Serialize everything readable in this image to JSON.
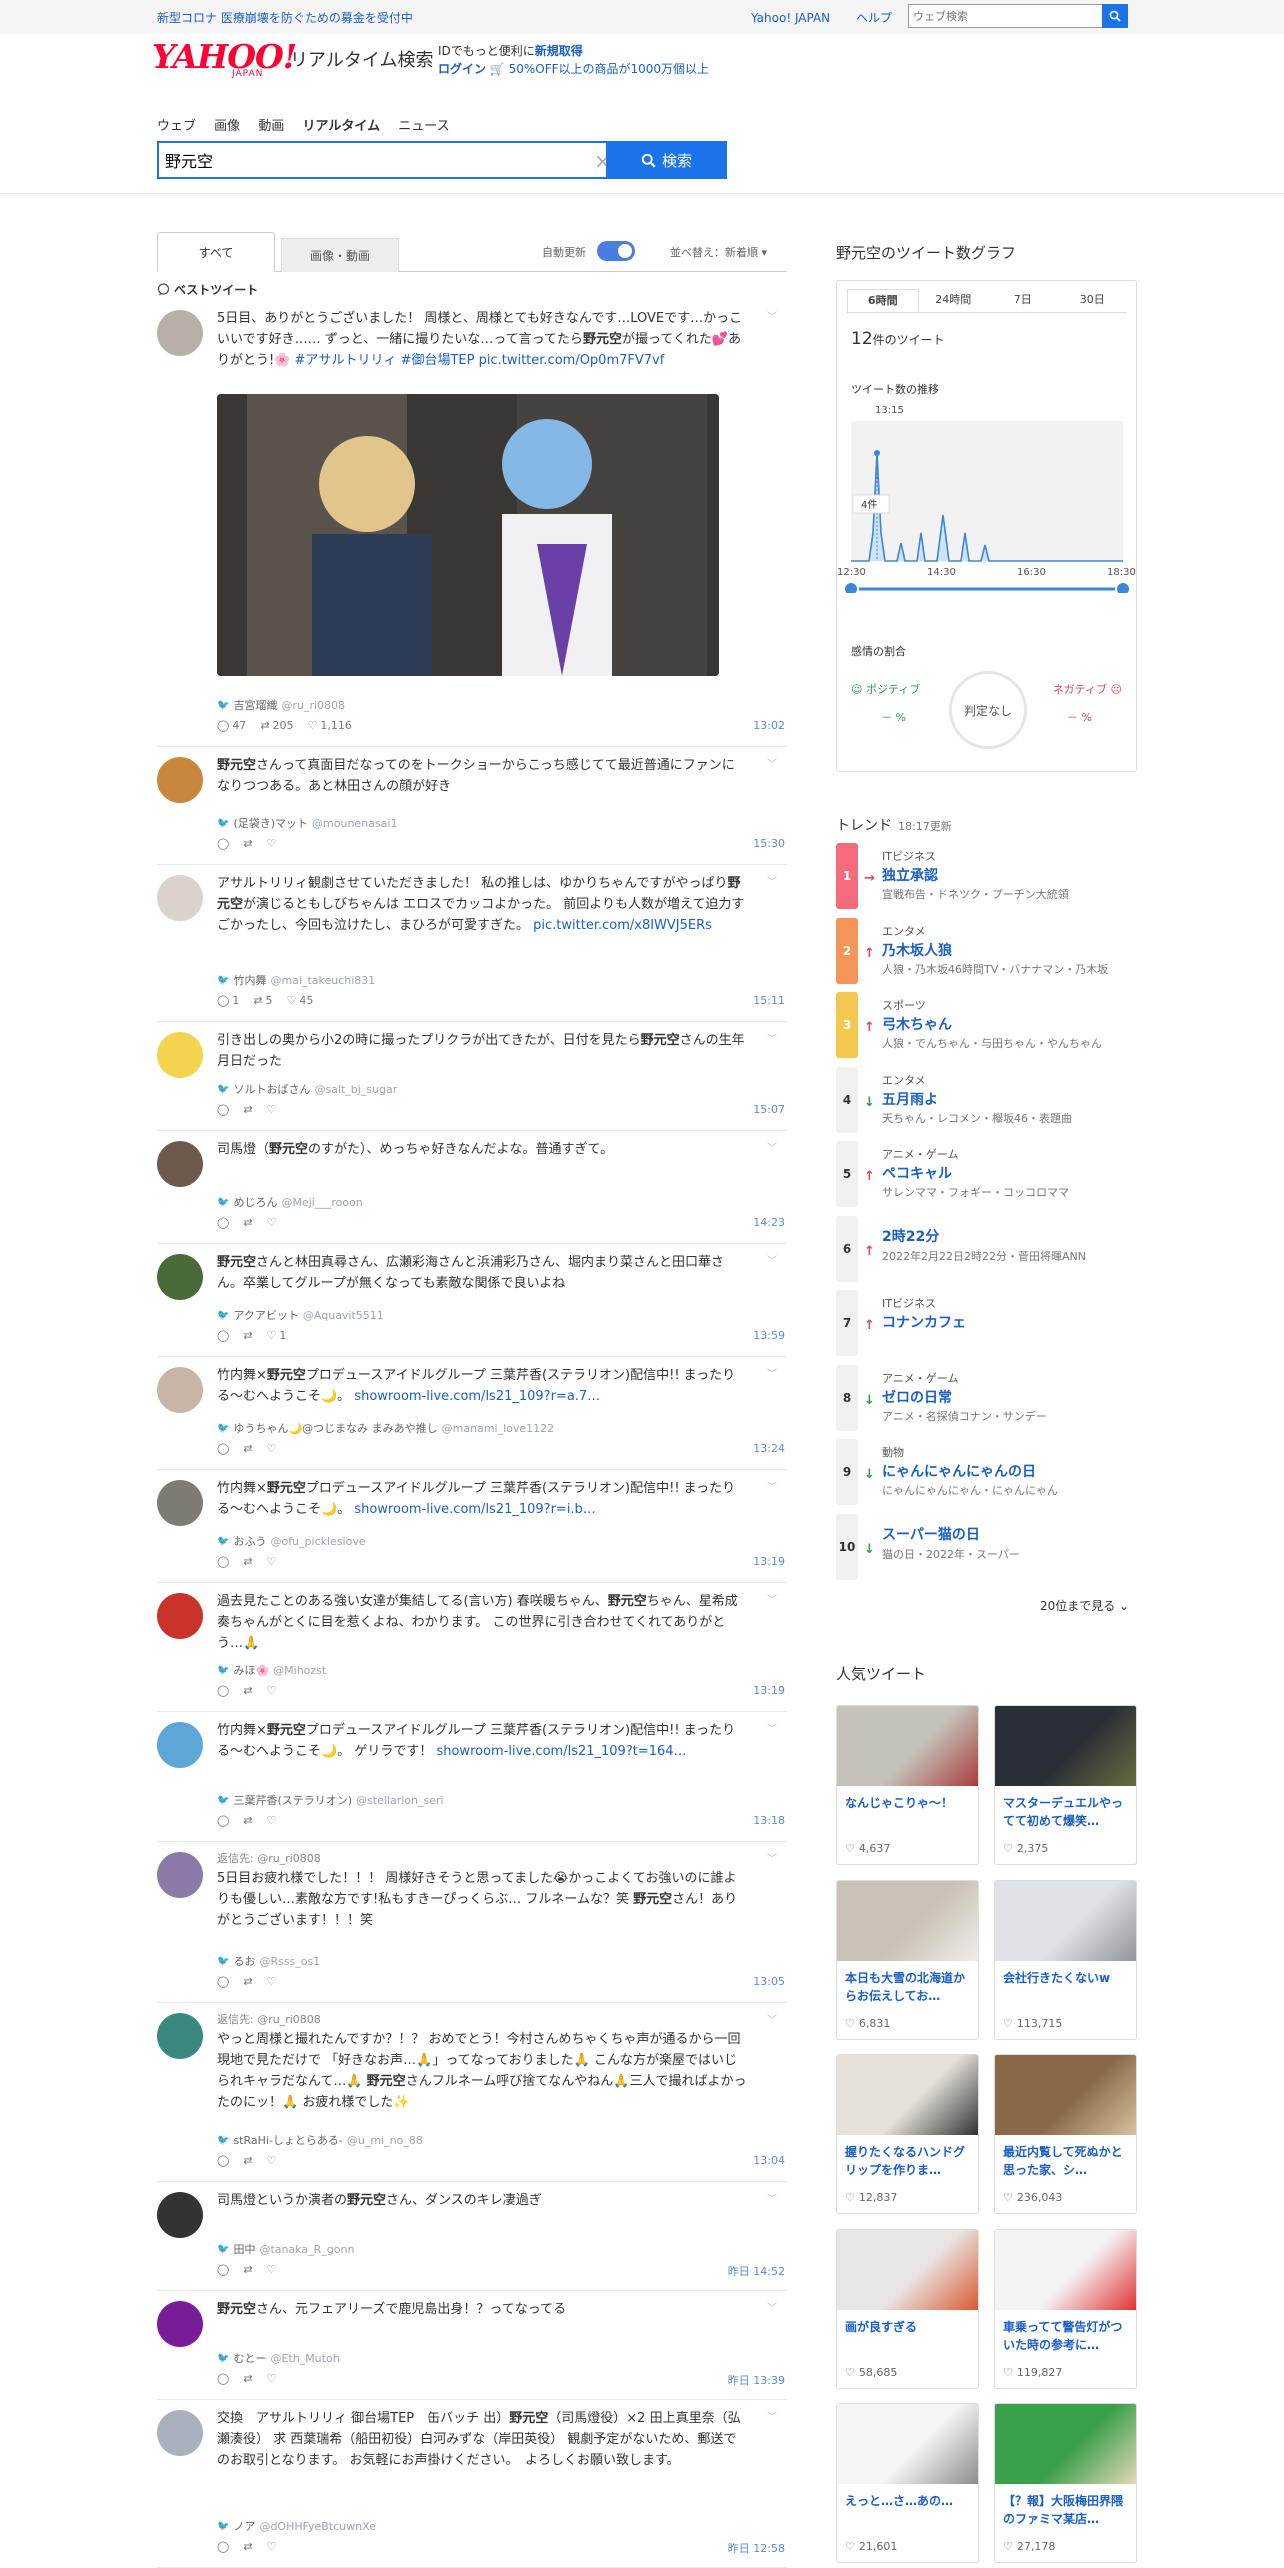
{
  "topbar": {
    "notice": "新型コロナ 医療崩壊を防ぐための募金を受付中",
    "links": [
      "Yahoo! JAPAN",
      "ヘルプ"
    ],
    "search_placeholder": "ウェブ検索"
  },
  "header": {
    "logo": "YAHOO!",
    "logo_sub": "JAPAN",
    "title": "リアルタイム検索",
    "promo_line1_pre": "IDでもっと便利に",
    "promo_line1_link": "新規取得",
    "promo_line2_link": "ログイン",
    "promo_line2_text": "🛒 50%OFF以上の商品が1000万個以上"
  },
  "nav": {
    "tabs": [
      "ウェブ",
      "画像",
      "動画",
      "リアルタイム",
      "ニュース"
    ],
    "active": "リアルタイム"
  },
  "search": {
    "query": "野元空",
    "button": "検索"
  },
  "filters": {
    "tab_all": "すべて",
    "tab_media": "画像・動画",
    "auto_update": "自動更新",
    "sort": "並べ替え：新着順 ▾"
  },
  "best_tweet_label": "ベストツイート",
  "tweets": [
    {
      "pre": "5日目、ありがとうございました！ 周様と、周様とても好きなんです…LOVEです…かっこいいです好き…… ずっと、一緒に撮りたいな…って言ってたら",
      "hl": "野元空",
      "post": "が撮ってくれた💕ありがとう!🌸",
      "link": "#アサルトリリィ #御台場TEP pic.twitter.com/Op0m7FV7vf",
      "user": "吉宮瑠織",
      "handle": "@ru_ri0808",
      "replies": "47",
      "retweets": "205",
      "likes": "1,116",
      "time": "13:02"
    },
    {
      "pre": "",
      "hl": "野元空",
      "post": "さんって真面目だなってのをトークショーからこっち感じてて最近普通にファンになりつつある。あと林田さんの顔が好き",
      "user": "(足袋き)マット",
      "handle": "@mounenasai1",
      "time": "15:30"
    },
    {
      "pre": "アサルトリリィ観劇させていただきました！ 私の推しは、ゆかりちゃんですがやっぱり",
      "hl": "野元空",
      "post": "が演じるともしびちゃんは エロスでカッコよかった。 前回よりも人数が増えて迫力すごかったし、今回も泣けたし、まひろが可愛すぎた。",
      "link": "pic.twitter.com/x8IWVJ5ERs",
      "user": "竹内舞",
      "handle": "@mai_takeuchi831",
      "replies": "1",
      "retweets": "5",
      "likes": "45",
      "time": "15:11"
    },
    {
      "pre": "引き出しの奥から小2の時に撮ったプリクラが出てきたが、日付を見たら",
      "hl": "野元空",
      "post": "さんの生年月日だった",
      "user": "ソルトおばさん",
      "handle": "@salt_bj_sugar",
      "time": "15:07"
    },
    {
      "pre": "司馬燈（",
      "hl": "野元空",
      "post": "のすがた）、めっちゃ好きなんだよな。普通すぎて。",
      "user": "めじろん",
      "handle": "@Meji___rooon",
      "time": "14:23"
    },
    {
      "pre": "",
      "hl": "野元空",
      "post": "さんと林田真尋さん、広瀬彩海さんと浜浦彩乃さん、堀内まり菜さんと田口華さん。卒業してグループが無くなっても素敵な関係で良いよね",
      "user": "アクアビット",
      "handle": "@Aquavit5511",
      "likes": "1",
      "time": "13:59"
    },
    {
      "pre": "竹内舞×",
      "hl": "野元空",
      "post": "プロデュースアイドルグループ 三葉芹香(ステラリオン)配信中!! まったりる〜むへようこそ🌙。",
      "link": "showroom-live.com/ls21_109?r=a.7…",
      "user": "ゆうちゃん🌙@つじまなみ まみあや推し",
      "handle": "@manami_love1122",
      "time": "13:24"
    },
    {
      "pre": "竹内舞×",
      "hl": "野元空",
      "post": "プロデュースアイドルグループ 三葉芹香(ステラリオン)配信中!! まったりる〜むへようこそ🌙。",
      "link": "showroom-live.com/ls21_109?r=i.b…",
      "user": "おふう",
      "handle": "@ofu_pickleslove",
      "time": "13:19"
    },
    {
      "pre": "過去見たことのある強い女達が集結してる(言い方) 春咲暖ちゃん、",
      "hl": "野元空",
      "post": "ちゃん、星希成奏ちゃんがとくに目を惹くよね、わかります。 この世界に引き合わせてくれてありがとう…🙏",
      "user": "みほ🌸",
      "handle": "@Mihozst",
      "time": "13:19"
    },
    {
      "pre": "竹内舞×",
      "hl": "野元空",
      "post": "プロデュースアイドルグループ 三葉芹香(ステラリオン)配信中!! まったりる〜むへようこそ🌙。 ゲリラです！",
      "link": "showroom-live.com/ls21_109?t=164…",
      "user": "三葉芹香(ステラリオン)",
      "handle": "@stellarion_seri",
      "time": "13:18"
    },
    {
      "reply_to": "返信先: @ru_ri0808",
      "pre": "5日目お疲れ様でした！！！ 周様好きそうと思ってました😭かっこよくてお強いのに誰よりも優しい…素敵な方です!私もすきーぴっくらぶ… フルネームな？笑 ",
      "hl": "野元空",
      "post": "さん！ありがとうございます！！！笑",
      "user": "るお",
      "handle": "@Rsss_os1",
      "time": "13:05"
    },
    {
      "reply_to": "返信先: @ru_ri0808",
      "pre": "やっと周様と撮れたんですか？！？ おめでとう！今村さんめちゃくちゃ声が通るから一回現地で見ただけで 「好きなお声…🙏」ってなっておりました🙏 こんな方が楽屋ではいじられキャラだなんて…🙏 ",
      "hl": "野元空",
      "post": "さんフルネーム呼び捨てなんやねん🙏三人で撮ればよかったのにッ！🙏 お疲れ様でした✨",
      "user": "stRaHi-しょとらある-",
      "handle": "@u_mi_no_88",
      "time": "13:04"
    },
    {
      "pre": "司馬燈というか演者の",
      "hl": "野元空",
      "post": "さん、ダンスのキレ凄過ぎ",
      "user": "田中",
      "handle": "@tanaka_R_gonn",
      "time": "昨日 14:52"
    },
    {
      "pre": "",
      "hl": "野元空",
      "post": "さん、元フェアリーズで鹿児島出身！？ってなってる",
      "user": "むとー",
      "handle": "@Eth_Mutoh",
      "time": "昨日 13:39"
    },
    {
      "pre": "交換　アサルトリリィ 御台場TEP　缶バッチ 出）",
      "hl": "野元空",
      "post": "（司馬燈役）×2 田上真里奈（弘瀬湊役） 求 西葉瑞希（船田初役）白河みずな（岸田英役） 観劇予定がないため、郵送でのお取引となります。 お気軽にお声掛けください。　よろしくお願い致します。",
      "user": "ノア",
      "handle": "@dOHHFyeBtcuwnXe",
      "time": "昨日 12:58"
    }
  ],
  "graph": {
    "title": "野元空のツイート数グラフ",
    "tabs": [
      "6時間",
      "24時間",
      "7日",
      "30日"
    ],
    "active_tab": "6時間",
    "count_num": "12",
    "count_suffix": "件のツイート",
    "trend_label": "ツイート数の推移",
    "peak_time": "13:15",
    "peak_value": "4件",
    "x_ticks": [
      "12:30",
      "14:30",
      "16:30",
      "18:30"
    ],
    "sentiment_label": "感情の割合",
    "positive_label": "ポジティブ",
    "negative_label": "ネガティブ",
    "positive_value": "－ %",
    "negative_value": "－ %",
    "judgement": "判定なし"
  },
  "chart_data": {
    "type": "area",
    "x": [
      "12:30",
      "14:30",
      "16:30",
      "18:30"
    ],
    "peak": {
      "x": "13:15",
      "y": 4
    },
    "total": 12
  },
  "trends": {
    "title": "トレンド",
    "updated": "18:17更新",
    "items": [
      {
        "rank": "1",
        "cat": "ITビジネス",
        "name": "独立承認",
        "rel": "宣戦布告・ドネツク・プーチン大統領",
        "dir": "→",
        "color": "#f46b7b"
      },
      {
        "rank": "2",
        "cat": "エンタメ",
        "name": "乃木坂人狼",
        "rel": "人狼・乃木坂46時間TV・バナナマン・乃木坂",
        "dir": "↑",
        "color": "#f59458"
      },
      {
        "rank": "3",
        "cat": "スポーツ",
        "name": "弓木ちゃん",
        "rel": "人狼・でんちゃん・与田ちゃん・やんちゃん",
        "dir": "↑",
        "color": "#f4c84e"
      },
      {
        "rank": "4",
        "cat": "エンタメ",
        "name": "五月雨よ",
        "rel": "天ちゃん・レコメン・欅坂46・表題曲",
        "dir": "↓",
        "color": "#f0f0f0"
      },
      {
        "rank": "5",
        "cat": "アニメ・ゲーム",
        "name": "ペコキャル",
        "rel": "サレンママ・フォギー・コッコロママ",
        "dir": "↑",
        "color": "#f0f0f0"
      },
      {
        "rank": "6",
        "cat": "",
        "name": "2時22分",
        "rel": "2022年2月22日2時22分・菅田将暉ANN",
        "dir": "↑",
        "color": "#f0f0f0"
      },
      {
        "rank": "7",
        "cat": "ITビジネス",
        "name": "コナンカフェ",
        "rel": "",
        "dir": "↑",
        "color": "#f0f0f0"
      },
      {
        "rank": "8",
        "cat": "アニメ・ゲーム",
        "name": "ゼロの日常",
        "rel": "アニメ・名探偵コナン・サンデー",
        "dir": "↓",
        "color": "#f0f0f0"
      },
      {
        "rank": "9",
        "cat": "動物",
        "name": "にゃんにゃんにゃんの日",
        "rel": "にゃんにゃんにゃん・にゃんにゃん",
        "dir": "↓",
        "color": "#f0f0f0"
      },
      {
        "rank": "10",
        "cat": "",
        "name": "スーパー猫の日",
        "rel": "猫の日・2022年・スーパー",
        "dir": "↓",
        "color": "#f0f0f0"
      }
    ],
    "more": "20位まで見る ⌄"
  },
  "popular": {
    "title": "人気ツイート",
    "items": [
      {
        "text": "なんじゃこりゃ～！",
        "likes": "4,637"
      },
      {
        "text": "マスターデュエルやってて初めて爆笑…",
        "likes": "2,375"
      },
      {
        "text": "本日も大雪の北海道からお伝えしてお…",
        "likes": "6,831"
      },
      {
        "text": "会社行きたくないw",
        "likes": "113,715"
      },
      {
        "text": "握りたくなるハンドグリップを作りま…",
        "likes": "12,837"
      },
      {
        "text": "最近内覧して死ぬかと思った家、シ…",
        "likes": "236,043"
      },
      {
        "text": "画が良すぎる",
        "likes": "58,685"
      },
      {
        "text": "車乗ってて警告灯がついた時の参考に…",
        "likes": "119,827"
      },
      {
        "text": "えっと…さ…あの…",
        "likes": "21,601"
      },
      {
        "text": "【？報】大阪梅田界隈のファミマ某店…",
        "likes": "27,178"
      }
    ]
  }
}
